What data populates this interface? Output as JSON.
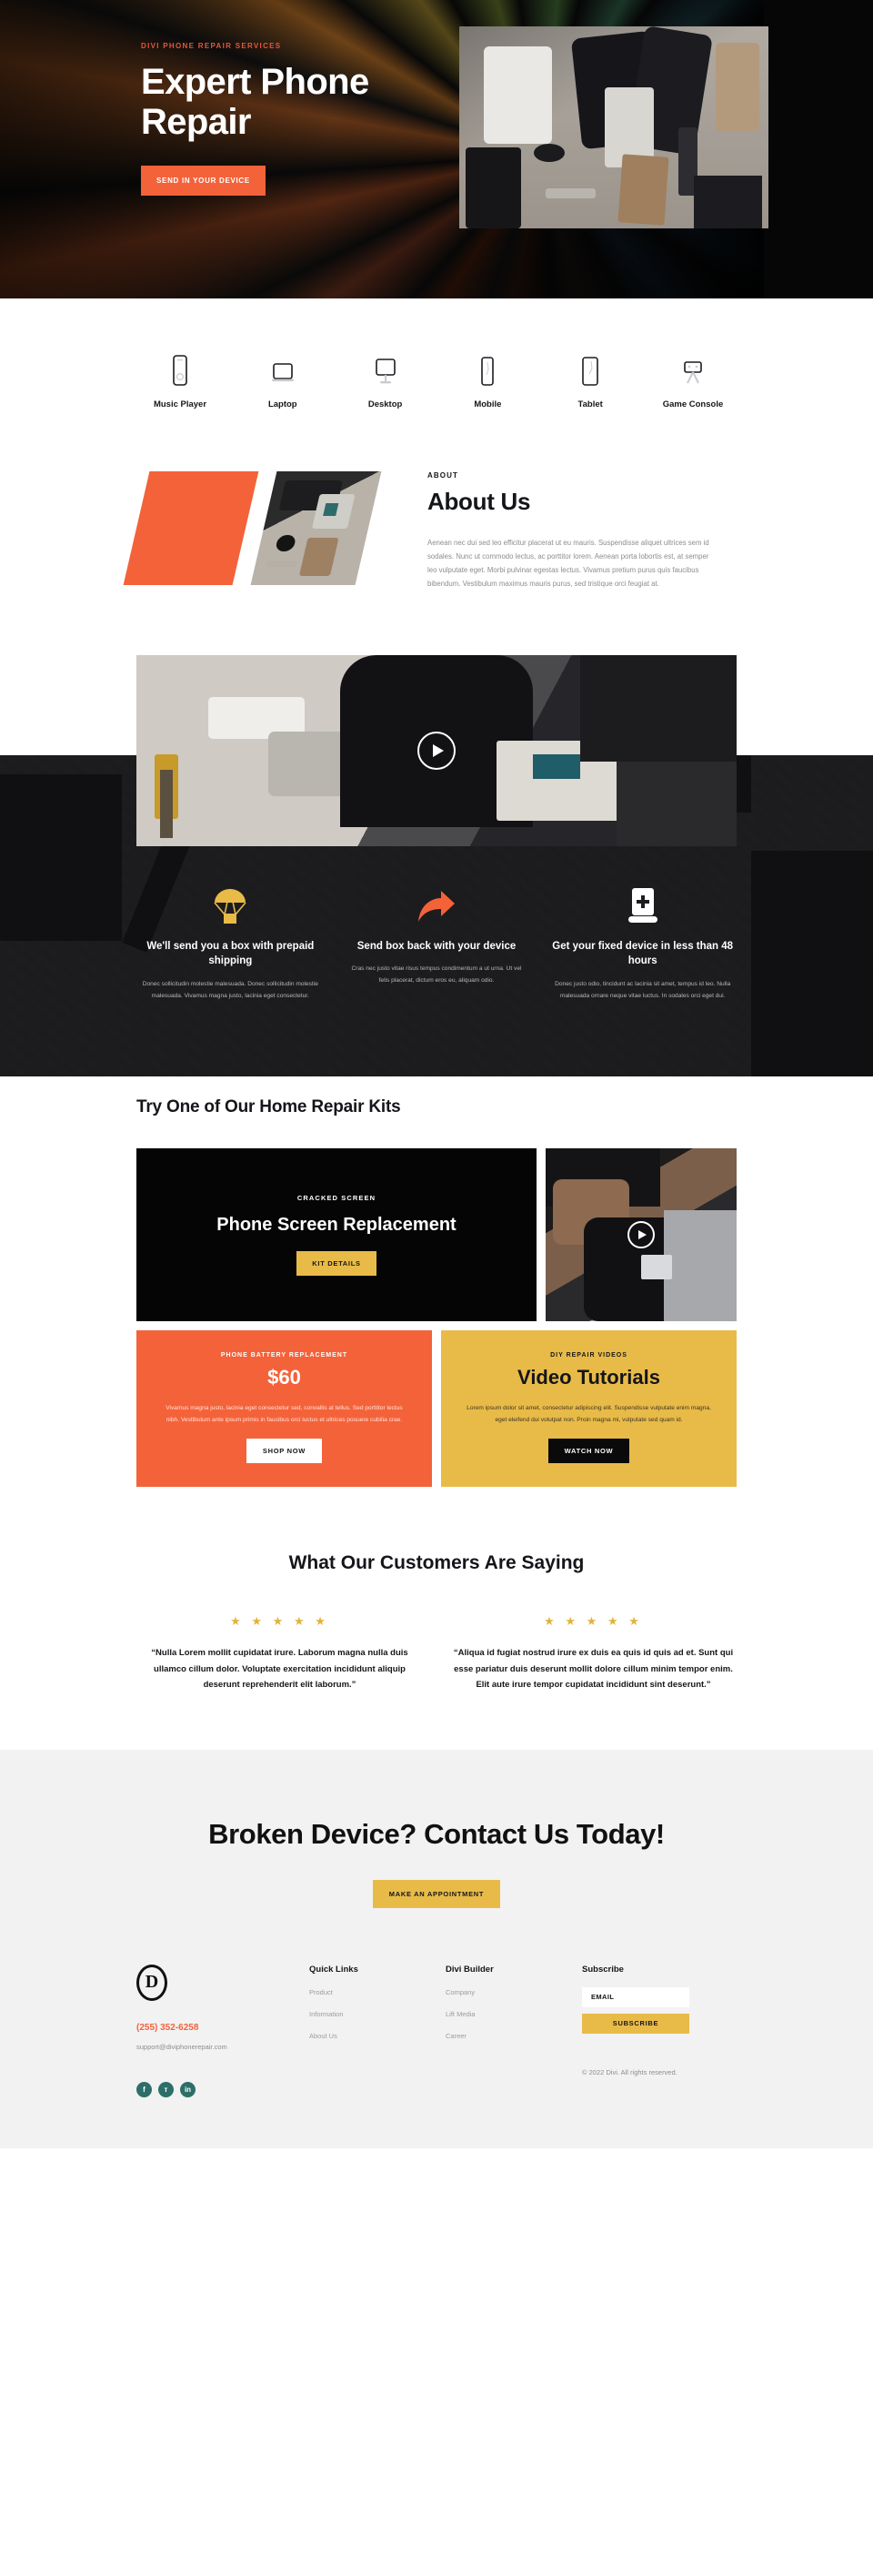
{
  "hero": {
    "eyebrow": "DIVI PHONE REPAIR SERVICES",
    "title": "Expert Phone Repair",
    "cta_label": "SEND IN YOUR DEVICE",
    "accent_color": "#f4623a",
    "photo_alt": "phone-repair-workbench-photo"
  },
  "devices": {
    "items": [
      {
        "label": "Music Player",
        "icon": "music-player-icon"
      },
      {
        "label": "Laptop",
        "icon": "laptop-icon"
      },
      {
        "label": "Desktop",
        "icon": "desktop-icon"
      },
      {
        "label": "Mobile",
        "icon": "mobile-icon"
      },
      {
        "label": "Tablet",
        "icon": "tablet-icon"
      },
      {
        "label": "Game Console",
        "icon": "game-console-icon"
      }
    ]
  },
  "about": {
    "eyebrow": "ABOUT",
    "title": "About Us",
    "body": "Aenean nec dui sed leo efficitur placerat ut eu mauris. Suspendisse aliquet ultrices sem id sodales. Nunc ut commodo lectus, ac porttitor lorem. Aenean porta lobortis est, at semper leo vulputate eget. Morbi pulvinar egestas lectus. Vivamus pretium purus quis faucibus bibendum. Vestibulum maximus mauris purus, sed tristique orci feugiat at."
  },
  "video": {
    "play_label": "play-button",
    "image_alt": "gloved-hands-repairing-phone"
  },
  "features": {
    "items": [
      {
        "icon": "parachute-box-icon",
        "icon_color": "#e8bb48",
        "title": "We'll send you a box with prepaid shipping",
        "body": "Donec sollicitudin molestie malesuada. Donec sollicitudin molestie malesuada. Vivamus magna justo, lacinia eget consectetur."
      },
      {
        "icon": "share-arrow-icon",
        "icon_color": "#f4623a",
        "title": "Send box back with your device",
        "body": "Cras nec justo vitae risus tempus condimentum a ut urna. Ut vel felis placerat, dictum eros eu, aliquam odio."
      },
      {
        "icon": "device-medical-icon",
        "icon_color": "#ffffff",
        "title": "Get your fixed device in less than 48 hours",
        "body": "Donec justo odio, tincidunt ac lacinia sit amet, tempus id leo. Nulla malesuada ornare neque vitae luctus. In sodales orci eget dui."
      }
    ]
  },
  "kits": {
    "title": "Try One of Our Home Repair Kits",
    "card_black": {
      "eyebrow": "CRACKED SCREEN",
      "title": "Phone Screen Replacement",
      "button": "KIT DETAILS"
    },
    "card_video": {
      "play_label": "play-button",
      "image_alt": "gloved-hands-holding-phone-part"
    },
    "card_orange": {
      "eyebrow": "PHONE BATTERY REPLACEMENT",
      "price": "$60",
      "body": "Vivamus magna justo, lacinia eget consectetur sed, convallis at tellus. Sed porttitor lectus nibh. Vestibulum ante ipsum primis in faucibus orci luctus et ultrices posuere cubilia crae.",
      "button": "SHOP NOW",
      "bg": "#f4623a"
    },
    "card_yellow": {
      "eyebrow": "DIY REPAIR VIDEOS",
      "title": "Video Tutorials",
      "body": "Lorem ipsum dolor sit amet, consectetur adipiscing elit. Suspendisse vulputate enim magna, eget eleifend dui volutpat non. Proin magna mi, vulputate sed quam id.",
      "button": "WATCH NOW",
      "bg": "#e8bb48"
    }
  },
  "testimonials": {
    "title": "What Our Customers Are Saying",
    "star_color": "#e2b33c",
    "items": [
      {
        "stars": "★ ★ ★ ★ ★",
        "rating": 5,
        "quote": "“Nulla Lorem mollit cupidatat irure. Laborum magna nulla duis ullamco cillum dolor. Voluptate exercitation incididunt aliquip deserunt reprehenderit elit laborum.”"
      },
      {
        "stars": "★ ★ ★ ★ ★",
        "rating": 5,
        "quote": "“Aliqua id fugiat nostrud irure ex duis ea quis id quis ad et. Sunt qui esse pariatur duis deserunt mollit dolore cillum minim tempor enim. Elit aute irure tempor cupidatat incididunt sint deserunt.”"
      }
    ]
  },
  "cta": {
    "title": "Broken Device? Contact Us Today!",
    "button": "MAKE AN APPOINTMENT",
    "button_color": "#e8bb48",
    "bg": "#f2f2f2"
  },
  "footer": {
    "logo_letter": "D",
    "phone": "(255) 352-6258",
    "email": "support@diviphonerepair.com",
    "socials": [
      {
        "name": "facebook-icon",
        "glyph": "f"
      },
      {
        "name": "twitter-icon",
        "glyph": "ᴛ"
      },
      {
        "name": "linkedin-icon",
        "glyph": "in"
      }
    ],
    "social_bg": "#2d6f68",
    "columns": [
      {
        "heading": "Quick Links",
        "links": [
          "Product",
          "Information",
          "About Us"
        ]
      },
      {
        "heading": "Divi Builder",
        "links": [
          "Company",
          "Lift Media",
          "Career"
        ]
      }
    ],
    "subscribe": {
      "heading": "Subscribe",
      "placeholder": "EMAIL",
      "value": "",
      "button": "SUBSCRIBE"
    },
    "copyright": "© 2022 Divi. All rights reserved."
  }
}
